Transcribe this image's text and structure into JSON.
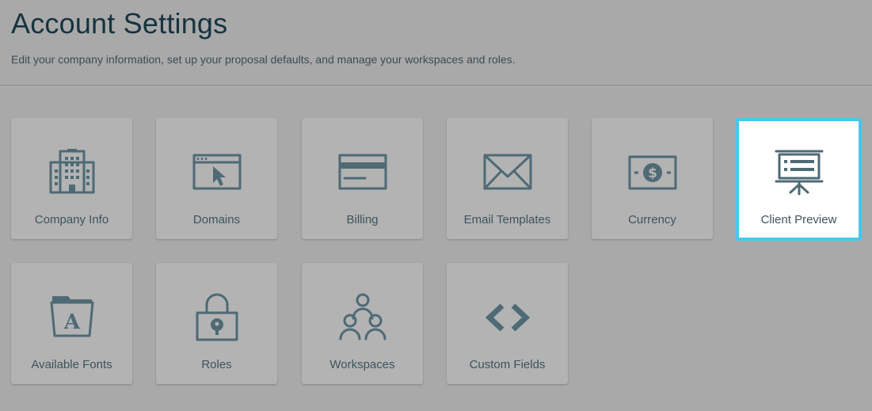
{
  "header": {
    "title": "Account Settings",
    "subtitle": "Edit your company information, set up your proposal defaults, and manage your workspaces and roles."
  },
  "tiles": [
    {
      "label": "Company Info",
      "icon": "building-icon"
    },
    {
      "label": "Domains",
      "icon": "browser-cursor-icon"
    },
    {
      "label": "Billing",
      "icon": "credit-card-icon"
    },
    {
      "label": "Email Templates",
      "icon": "envelope-icon"
    },
    {
      "label": "Currency",
      "icon": "dollar-bill-icon"
    },
    {
      "label": "Client Preview",
      "icon": "presentation-board-icon",
      "selected": true
    },
    {
      "label": "Available Fonts",
      "icon": "font-folder-icon"
    },
    {
      "label": "Roles",
      "icon": "padlock-icon"
    },
    {
      "label": "Workspaces",
      "icon": "users-group-icon"
    },
    {
      "label": "Custom Fields",
      "icon": "code-brackets-icon"
    }
  ],
  "colors": {
    "background": "#a9a9a9",
    "tile": "#b3b3b3",
    "icon": "#4e6a75",
    "selected_border": "#45c8ee",
    "title": "#17333f"
  }
}
